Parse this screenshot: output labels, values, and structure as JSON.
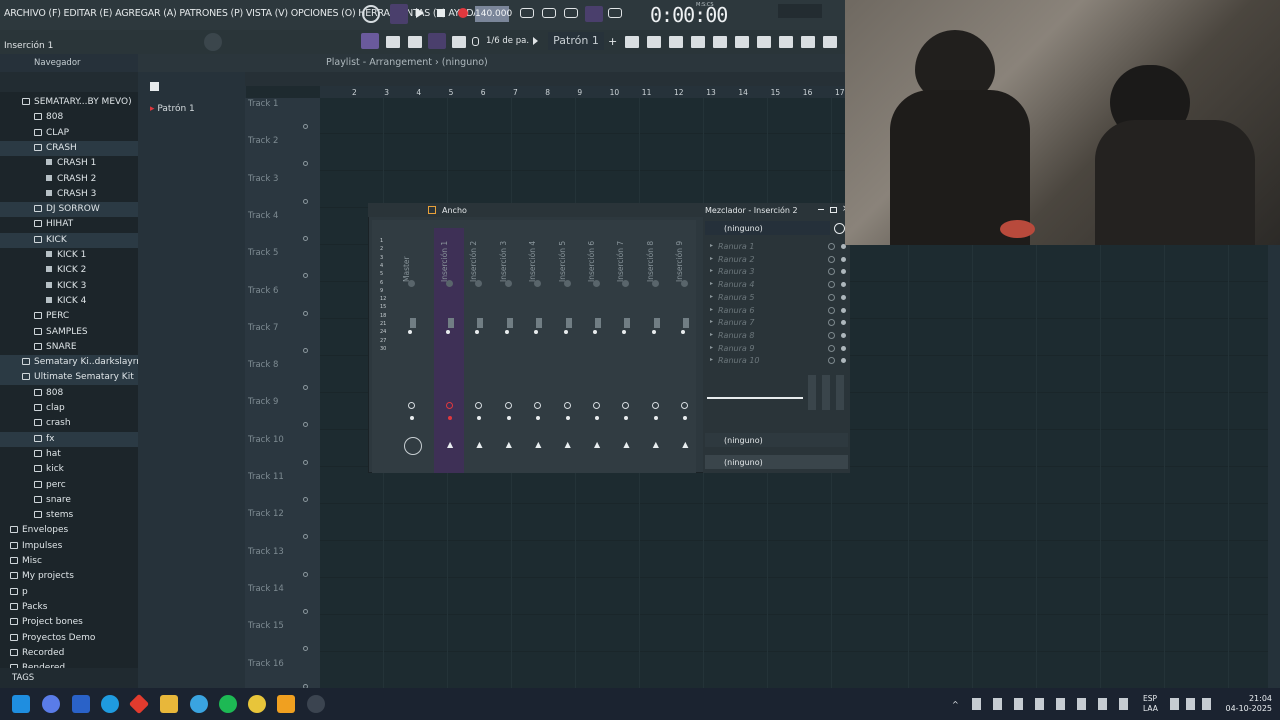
{
  "menubar": {
    "text": "ARCHIVO (F) EDITAR (E) AGREGAR (A) PATRONES (P) VISTA (V) OPCIONES (O) HERRAMIENTAS (T) AYUDA",
    "tempo": "140.000",
    "time": "0:00:00",
    "time_unit": "M:S:CS",
    "hint": "Inserción 1",
    "snap": "1/6 de pa.",
    "pattern": "Patrón 1"
  },
  "browser": {
    "title": "Navegador",
    "items": [
      {
        "label": "SEMATARY...BY MEVO)",
        "kind": "folder",
        "indent": 1
      },
      {
        "label": "808",
        "kind": "folder",
        "indent": 2
      },
      {
        "label": "CLAP",
        "kind": "folder",
        "indent": 2
      },
      {
        "label": "CRASH",
        "kind": "folder",
        "indent": 2
      },
      {
        "label": "CRASH 1",
        "kind": "sample",
        "indent": 3
      },
      {
        "label": "CRASH 2",
        "kind": "sample",
        "indent": 3
      },
      {
        "label": "CRASH 3",
        "kind": "sample",
        "indent": 3
      },
      {
        "label": "DJ SORROW",
        "kind": "folder",
        "indent": 2
      },
      {
        "label": "HIHAT",
        "kind": "folder",
        "indent": 2
      },
      {
        "label": "KICK",
        "kind": "folder",
        "indent": 2
      },
      {
        "label": "KICK 1",
        "kind": "sample",
        "indent": 3
      },
      {
        "label": "KICK 2",
        "kind": "sample",
        "indent": 3
      },
      {
        "label": "KICK 3",
        "kind": "sample",
        "indent": 3
      },
      {
        "label": "KICK 4",
        "kind": "sample",
        "indent": 3
      },
      {
        "label": "PERC",
        "kind": "folder",
        "indent": 2
      },
      {
        "label": "SAMPLES",
        "kind": "folder",
        "indent": 2
      },
      {
        "label": "SNARE",
        "kind": "folder",
        "indent": 2
      },
      {
        "label": "Sematary Ki..darkslayrr]",
        "kind": "folder",
        "indent": 1
      },
      {
        "label": "Ultimate Sematary Kit",
        "kind": "folder",
        "indent": 1
      },
      {
        "label": "808",
        "kind": "folder",
        "indent": 2
      },
      {
        "label": "clap",
        "kind": "folder",
        "indent": 2
      },
      {
        "label": "crash",
        "kind": "folder",
        "indent": 2
      },
      {
        "label": "fx",
        "kind": "folder",
        "indent": 2
      },
      {
        "label": "hat",
        "kind": "folder",
        "indent": 2
      },
      {
        "label": "kick",
        "kind": "folder",
        "indent": 2
      },
      {
        "label": "perc",
        "kind": "folder",
        "indent": 2
      },
      {
        "label": "snare",
        "kind": "folder",
        "indent": 2
      },
      {
        "label": "stems",
        "kind": "folder",
        "indent": 2
      },
      {
        "label": "Envelopes",
        "kind": "folder",
        "indent": 0
      },
      {
        "label": "Impulses",
        "kind": "folder",
        "indent": 0
      },
      {
        "label": "Misc",
        "kind": "folder",
        "indent": 0
      },
      {
        "label": "My projects",
        "kind": "folder",
        "indent": 0
      },
      {
        "label": "p",
        "kind": "folder",
        "indent": 0
      },
      {
        "label": "Packs",
        "kind": "folder",
        "indent": 0
      },
      {
        "label": "Project bones",
        "kind": "folder",
        "indent": 0
      },
      {
        "label": "Proyectos Demo",
        "kind": "folder",
        "indent": 0
      },
      {
        "label": "Recorded",
        "kind": "special",
        "indent": 0
      },
      {
        "label": "Rendered",
        "kind": "special",
        "indent": 0
      }
    ],
    "tags": "TAGS"
  },
  "channel_rack": {
    "pattern_item": "Patrón 1"
  },
  "playlist": {
    "title": "Playlist - Arrangement › (ninguno)",
    "ruler": [
      "2",
      "3",
      "4",
      "5",
      "6",
      "7",
      "8",
      "9",
      "10",
      "11",
      "12",
      "13",
      "14",
      "15",
      "16",
      "17"
    ],
    "tracks": [
      "Track 1",
      "Track 2",
      "Track 3",
      "Track 4",
      "Track 5",
      "Track 6",
      "Track 7",
      "Track 8",
      "Track 9",
      "Track 10",
      "Track 11",
      "Track 12",
      "Track 13",
      "Track 14",
      "Track 15",
      "Track 16"
    ]
  },
  "mixer": {
    "mode": "Ancho",
    "title": "Mezclador - Inserción 2",
    "selected_num": "2",
    "strips": [
      "Master",
      "Inserción 1",
      "Inserción 2",
      "Inserción 3",
      "Inserción 4",
      "Inserción 5",
      "Inserción 6",
      "Inserción 7",
      "Inserción 8",
      "Inserción 9"
    ],
    "meter_ticks": [
      "1",
      "2",
      "3",
      "4",
      "5",
      "6",
      "9",
      "12",
      "15",
      "18",
      "21",
      "24",
      "27",
      "30"
    ],
    "insert": {
      "input": "(ninguno)",
      "routes": [
        "Ranura 1",
        "Ranura 2",
        "Ranura 3",
        "Ranura 4",
        "Ranura 5",
        "Ranura 6",
        "Ranura 7",
        "Ranura 8",
        "Ranura 9",
        "Ranura 10"
      ],
      "eq_label": "(ninguno)",
      "output": "(ninguno)"
    }
  },
  "taskbar": {
    "lang": "ESP",
    "lang2": "LAA",
    "time": "21:04",
    "date": "04-10-2025"
  },
  "colors": {
    "accent": "#8a6cc2",
    "record": "#e0383e"
  }
}
